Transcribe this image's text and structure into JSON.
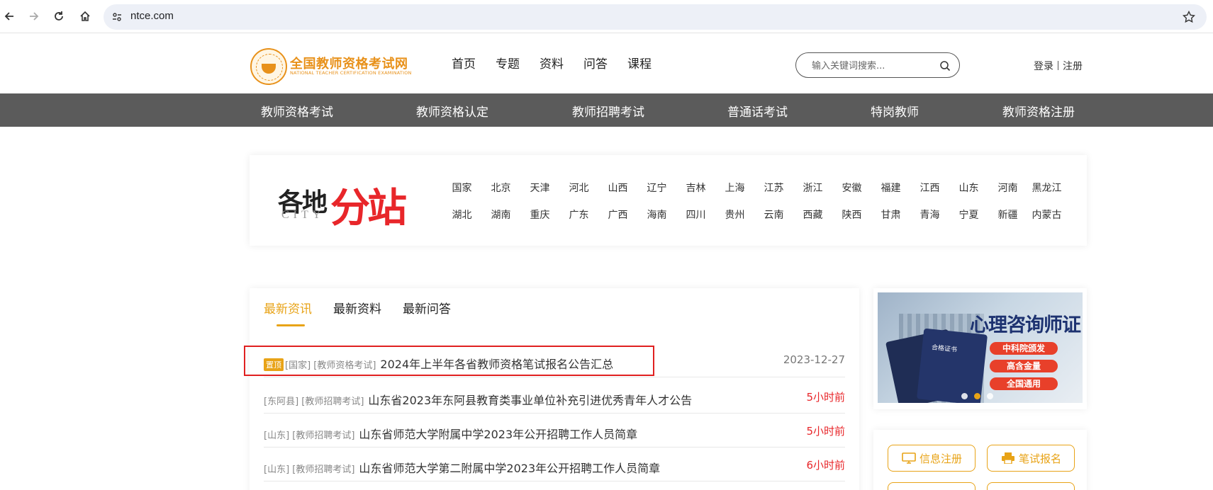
{
  "browser": {
    "url": "ntce.com"
  },
  "header": {
    "logo_title": "全国教师资格考试网",
    "logo_sub": "NATIONAL TEACHER CERTIFICATION EXAMINATION",
    "nav": [
      "首页",
      "专题",
      "资料",
      "问答",
      "课程"
    ],
    "search_placeholder": "输入关键词搜索...",
    "login": "登录",
    "register": "注册"
  },
  "categories": [
    "教师资格考试",
    "教师资格认定",
    "教师招聘考试",
    "普通话考试",
    "特岗教师",
    "教师资格注册"
  ],
  "city": {
    "title_a": "各地",
    "title_b": "分站",
    "title_en": "CITY",
    "row1": [
      "国家",
      "北京",
      "天津",
      "河北",
      "山西",
      "辽宁",
      "吉林",
      "上海",
      "江苏",
      "浙江",
      "安徽",
      "福建",
      "江西",
      "山东",
      "河南",
      "黑龙江"
    ],
    "row2": [
      "湖北",
      "湖南",
      "重庆",
      "广东",
      "广西",
      "海南",
      "四川",
      "贵州",
      "云南",
      "西藏",
      "陕西",
      "甘肃",
      "青海",
      "宁夏",
      "新疆",
      "内蒙古"
    ]
  },
  "news": {
    "tabs": [
      "最新资讯",
      "最新资料",
      "最新问答"
    ],
    "active_tab": 0,
    "items": [
      {
        "badge": "置顶",
        "tags": "[国家] [教师资格考试]",
        "title": "2024年上半年各省教师资格笔试报名公告汇总",
        "date": "2023-12-27"
      },
      {
        "tags": "[东阿县] [教师招聘考试]",
        "title": "山东省2023年东阿县教育类事业单位补充引进优秀青年人才公告",
        "time": "5小时前"
      },
      {
        "tags": "[山东] [教师招聘考试]",
        "title": "山东省师范大学附属中学2023年公开招聘工作人员简章",
        "time": "5小时前"
      },
      {
        "tags": "[山东] [教师招聘考试]",
        "title": "山东省师范大学第二附属中学2023年公开招聘工作人员简章",
        "time": "6小时前"
      }
    ]
  },
  "banner": {
    "title": "心理咨询师证",
    "pills": [
      "中科院颁发",
      "高含金量",
      "全国通用"
    ],
    "cert_label": "合格证书",
    "active_dot": 1
  },
  "services": {
    "info_register": "信息注册",
    "written_signup": "笔试报名"
  },
  "colors": {
    "accent": "#e8a317",
    "red": "#e8262a",
    "category_bar": "#5b5b5b"
  }
}
